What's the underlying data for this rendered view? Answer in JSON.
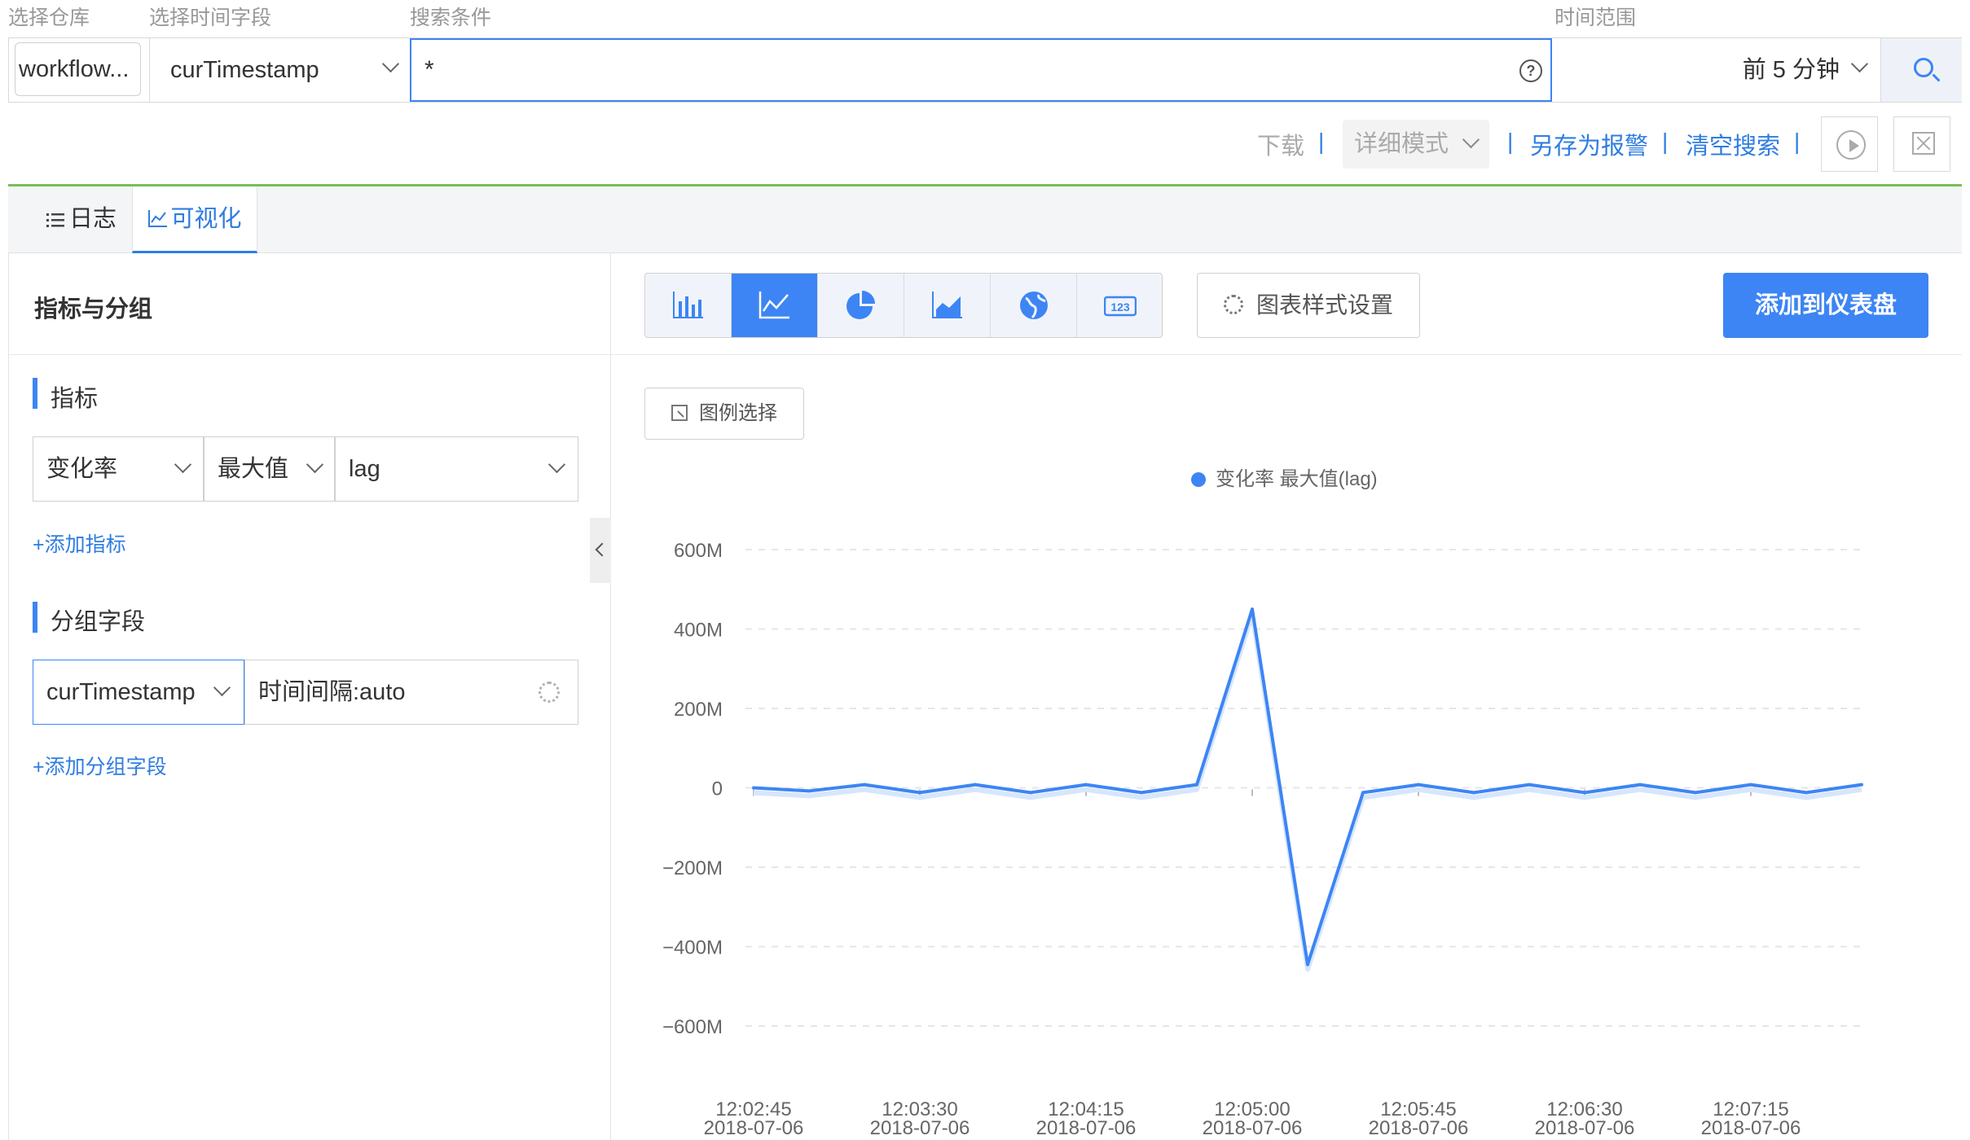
{
  "labels": {
    "repo": "选择仓库",
    "time_field": "选择时间字段",
    "query": "搜索条件",
    "time_range": "时间范围"
  },
  "search": {
    "repo_value": "workflow...",
    "time_field_value": "curTimestamp",
    "query_value": "*",
    "help_glyph": "?",
    "time_range_value": "前 5 分钟"
  },
  "actions": {
    "download": "下载",
    "mode": "详细模式",
    "save_alert": "另存为报警",
    "clear_search": "清空搜索",
    "separator": "|"
  },
  "tabs": {
    "log": "日志",
    "visual": "可视化"
  },
  "left": {
    "title": "指标与分组",
    "metrics_title": "指标",
    "metric_func": "变化率",
    "metric_agg": "最大值",
    "metric_field": "lag",
    "add_metric": "+添加指标",
    "group_title": "分组字段",
    "group_field": "curTimestamp",
    "group_interval": "时间间隔:auto",
    "add_group": "+添加分组字段"
  },
  "right": {
    "style_settings": "图表样式设置",
    "add_dashboard": "添加到仪表盘",
    "legend_select": "图例选择",
    "chart_type_selected": "line",
    "chart_type_icons": [
      "bar-chart-icon",
      "line-chart-icon",
      "pie-chart-icon",
      "area-chart-icon",
      "globe-icon",
      "number-icon"
    ]
  },
  "colors": {
    "accent": "#3d85f4",
    "link": "#2f7de1",
    "divider_green": "#76c057"
  },
  "chart_data": {
    "type": "line",
    "series": [
      {
        "name": "变化率 最大值(lag)",
        "values": [
          0,
          -8,
          8,
          -12,
          8,
          -12,
          8,
          -12,
          8,
          450,
          -445,
          -12,
          8,
          -12,
          8,
          -12,
          8,
          -12,
          8,
          -12,
          8
        ]
      }
    ],
    "x_ticks": [
      {
        "index": 0,
        "time": "12:02:45",
        "date": "2018-07-06"
      },
      {
        "index": 3,
        "time": "12:03:30",
        "date": "2018-07-06"
      },
      {
        "index": 6,
        "time": "12:04:15",
        "date": "2018-07-06"
      },
      {
        "index": 9,
        "time": "12:05:00",
        "date": "2018-07-06"
      },
      {
        "index": 12,
        "time": "12:05:45",
        "date": "2018-07-06"
      },
      {
        "index": 15,
        "time": "12:06:30",
        "date": "2018-07-06"
      },
      {
        "index": 18,
        "time": "12:07:15",
        "date": "2018-07-06"
      }
    ],
    "y_ticks": [
      {
        "value": 600,
        "label": "600M"
      },
      {
        "value": 400,
        "label": "400M"
      },
      {
        "value": 200,
        "label": "200M"
      },
      {
        "value": 0,
        "label": "0"
      },
      {
        "value": -200,
        "label": "−200M"
      },
      {
        "value": -400,
        "label": "−400M"
      },
      {
        "value": -600,
        "label": "−600M"
      }
    ],
    "ylim": [
      -600,
      600
    ],
    "grid": true,
    "legend_position": "top-center",
    "unit": "M"
  }
}
